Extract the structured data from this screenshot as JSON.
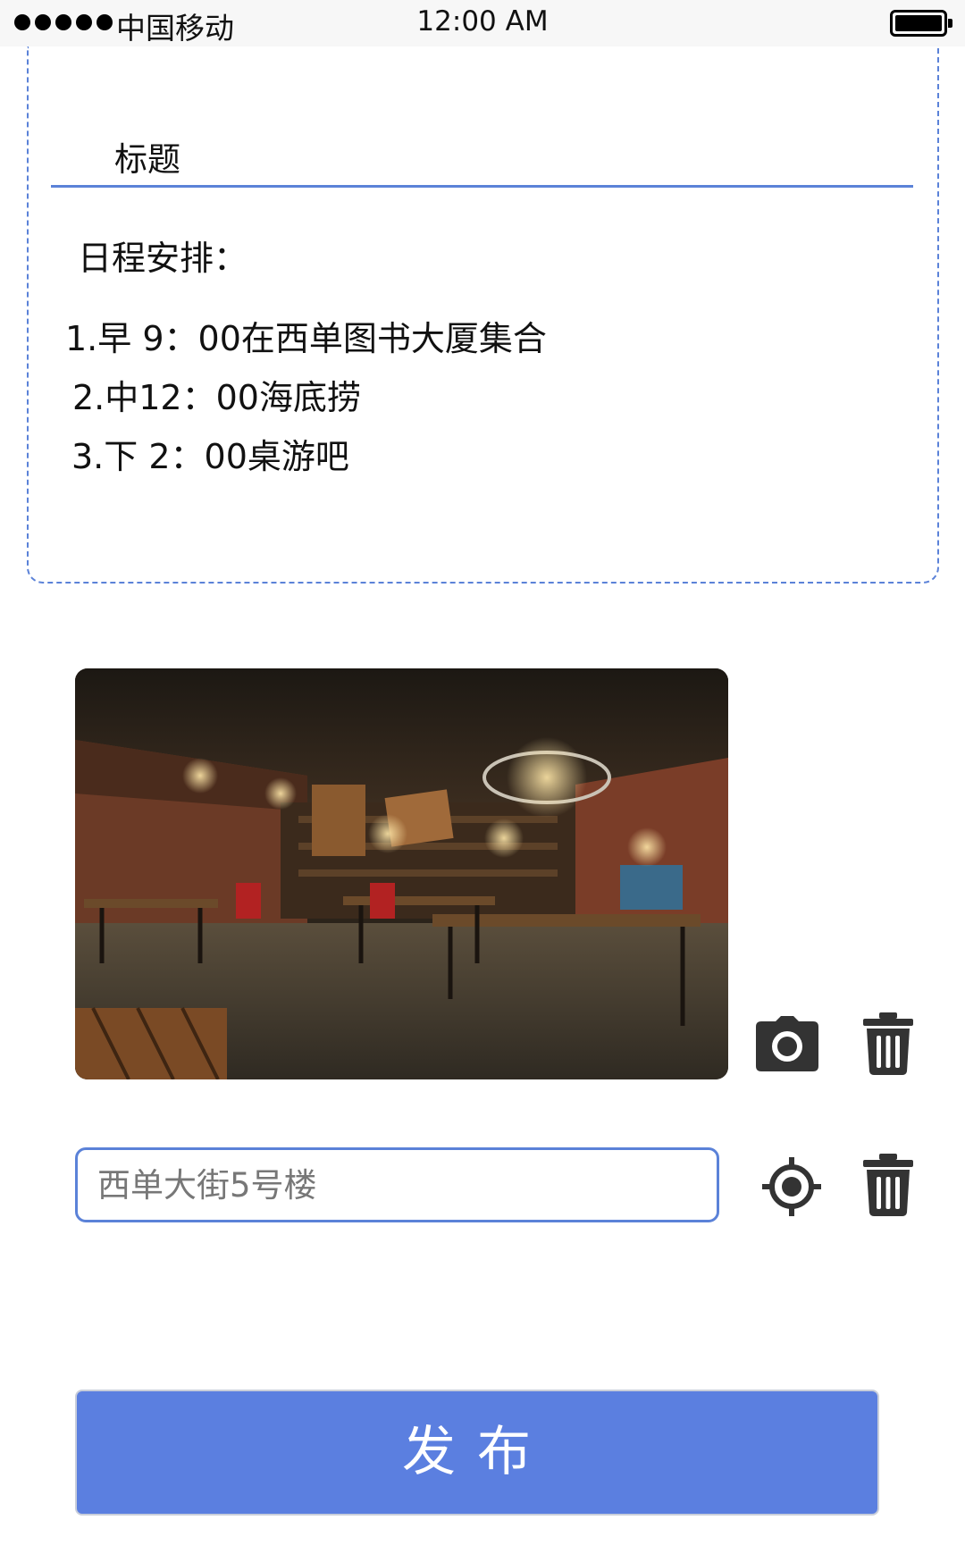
{
  "status_bar": {
    "carrier": "中国移动",
    "time": "12:00 AM"
  },
  "card": {
    "title": "标题",
    "schedule_heading": "日程安排：",
    "items": [
      "1.早 9：00在西单图书大厦集合",
      "2.中12：00海底捞",
      "3.下 2：00桌游吧"
    ]
  },
  "photo": {
    "icons": {
      "camera": "camera-icon",
      "delete": "trash-icon"
    }
  },
  "address": {
    "value": "",
    "placeholder": "西单大街5号楼",
    "icons": {
      "locate": "locate-icon",
      "delete": "trash-icon"
    }
  },
  "publish": {
    "label": "发布"
  },
  "colors": {
    "accent": "#5b82d8",
    "button": "#5b7fe0",
    "icon": "#333333"
  }
}
